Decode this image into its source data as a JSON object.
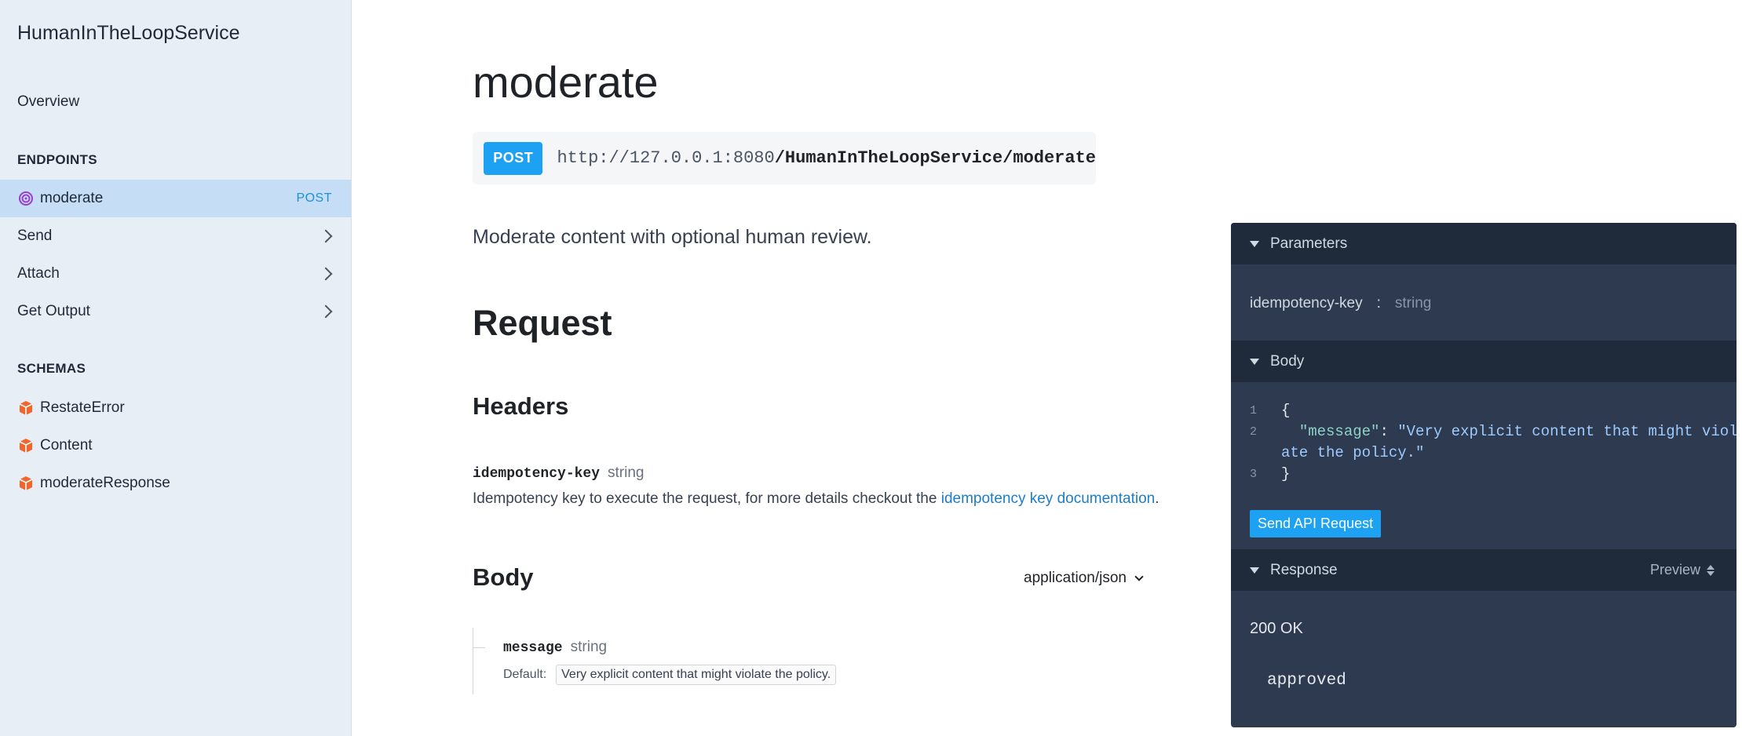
{
  "sidebar": {
    "title": "HumanInTheLoopService",
    "overview": "Overview",
    "endpoints_label": "ENDPOINTS",
    "endpoints": [
      {
        "label": "moderate",
        "method": "POST"
      },
      {
        "label": "Send"
      },
      {
        "label": "Attach"
      },
      {
        "label": "Get Output"
      }
    ],
    "schemas_label": "SCHEMAS",
    "schemas": [
      {
        "label": "RestateError"
      },
      {
        "label": "Content"
      },
      {
        "label": "moderateResponse"
      }
    ]
  },
  "main": {
    "title": "moderate",
    "method": "POST",
    "url_host": "http://127.0.0.1:8080",
    "url_path": "/HumanInTheLoopService/moderate",
    "description": "Moderate content with optional human review.",
    "request_heading": "Request",
    "headers_heading": "Headers",
    "header_param": {
      "name": "idempotency-key",
      "type": "string",
      "desc_prefix": "Idempotency key to execute the request, for more details checkout the ",
      "desc_link": "idempotency key documentation",
      "desc_suffix": "."
    },
    "body_heading": "Body",
    "content_type": "application/json",
    "body_param": {
      "name": "message",
      "type": "string",
      "default_label": "Default:",
      "default_value": "Very explicit content that might violate the policy."
    }
  },
  "panel": {
    "parameters_label": "Parameters",
    "param_name": "idempotency-key",
    "param_sep": ":",
    "param_type": "string",
    "body_label": "Body",
    "code": {
      "l1": "1",
      "l2": "2",
      "l3": "3",
      "open": "{",
      "key": "\"message\"",
      "colon": ": ",
      "value_part1": "\"Very explicit content that might viol",
      "value_part2": "ate the policy.\"",
      "close": "}"
    },
    "send_button": "Send API Request",
    "response_label": "Response",
    "preview_label": "Preview",
    "status": "200 OK",
    "response_body": "approved"
  },
  "colors": {
    "accent": "#1da1f2",
    "sidebar_bg": "#e8eef5",
    "active_row": "#c5def6",
    "panel_bg": "#2d3a4f",
    "panel_header": "#1f2a3b",
    "schema_icon": "#f0662b"
  }
}
